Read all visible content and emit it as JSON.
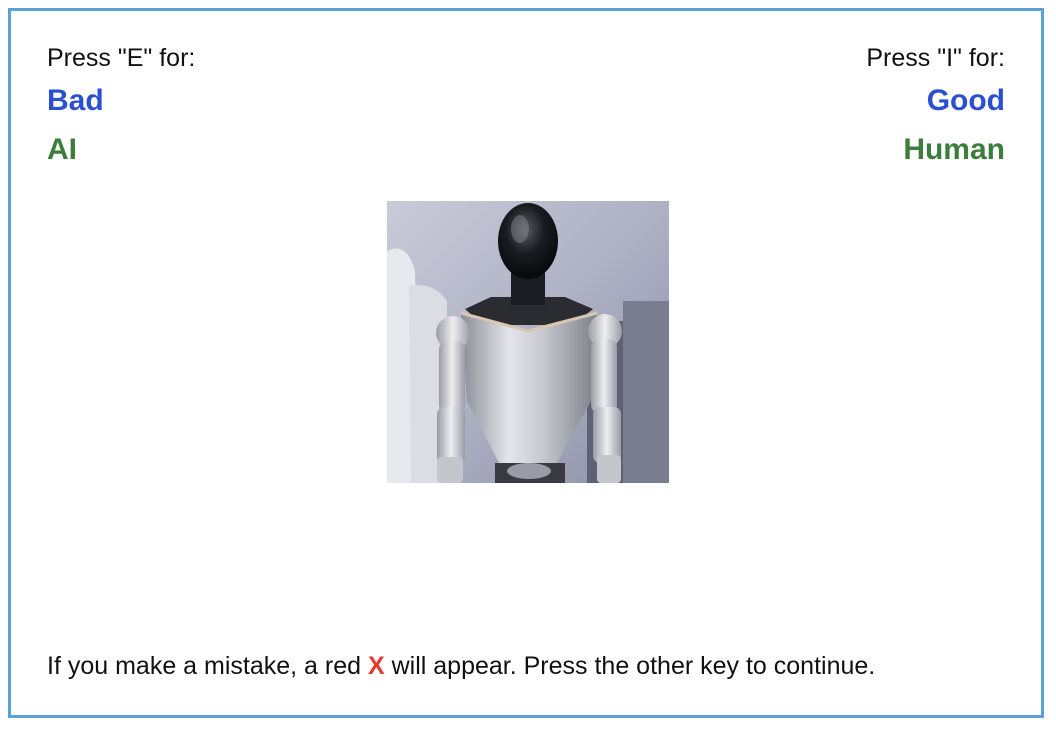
{
  "left": {
    "prompt": "Press \"E\" for:",
    "category_top": "Bad",
    "category_bottom": "AI"
  },
  "right": {
    "prompt": "Press \"I\" for:",
    "category_top": "Good",
    "category_bottom": "Human"
  },
  "stimulus": {
    "icon": "humanoid-robot-photo"
  },
  "instructions": {
    "before": "If you make a mistake, a red ",
    "mark": "X",
    "after": " will appear. Press the other key to continue."
  },
  "colors": {
    "border": "#5aa2da",
    "category_top": "#2a4fd0",
    "category_bottom": "#3b7d3b",
    "error_mark": "#e53b2f"
  }
}
